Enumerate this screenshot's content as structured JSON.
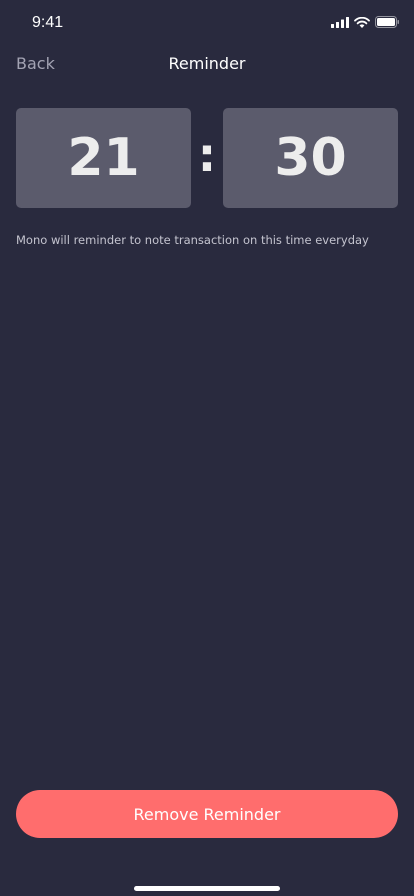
{
  "status_bar": {
    "time": "9:41",
    "icons": [
      "cellular-signal-icon",
      "wifi-icon",
      "battery-icon"
    ]
  },
  "nav": {
    "back_label": "Back",
    "title": "Reminder"
  },
  "time_picker": {
    "hour": "21",
    "separator": ":",
    "minute": "30"
  },
  "hint": "Mono will reminder to note transaction on this time everyday",
  "remove_button_label": "Remove Reminder",
  "colors": {
    "background": "#292A3E",
    "time_box": "#5B5B6C",
    "accent": "#FF6D6D",
    "muted_text": "#A3A3B3"
  }
}
